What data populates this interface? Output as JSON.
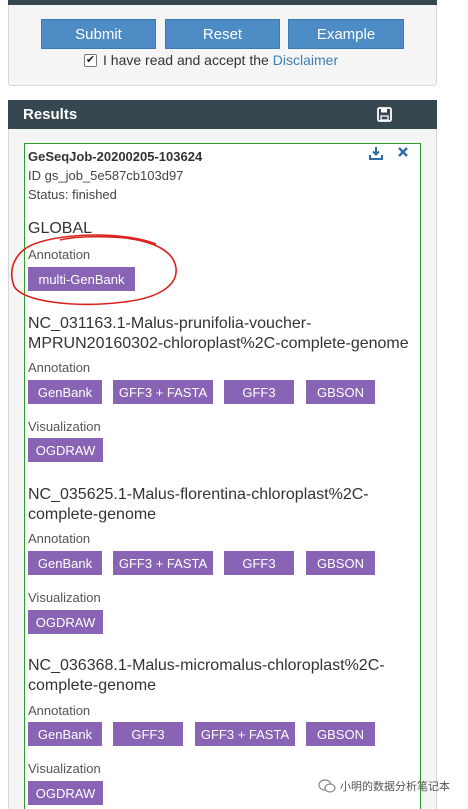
{
  "form": {
    "submit_label": "Submit",
    "reset_label": "Reset",
    "example_label": "Example",
    "disclaimer_checked": true,
    "disclaimer_text": "I have read and accept the",
    "disclaimer_link": "Disclaimer"
  },
  "results": {
    "header": "Results",
    "job": {
      "title": "GeSeqJob-20200205-103624",
      "id": "ID gs_job_5e587cb103d97",
      "status": "Status: finished"
    },
    "global": {
      "title": "GLOBAL",
      "annotation_label": "Annotation",
      "buttons": [
        "multi-GenBank"
      ]
    },
    "genomes": [
      {
        "title": "NC_031163.1-Malus-prunifolia-voucher-MPRUN20160302-chloroplast%2C-complete-genome",
        "annotation_label": "Annotation",
        "annotation_buttons": [
          "GenBank",
          "GFF3 + FASTA",
          "GFF3",
          "GBSON"
        ],
        "visualization_label": "Visualization",
        "visualization_buttons": [
          "OGDRAW"
        ]
      },
      {
        "title": "NC_035625.1-Malus-florentina-chloroplast%2C-complete-genome",
        "annotation_label": "Annotation",
        "annotation_buttons": [
          "GenBank",
          "GFF3 + FASTA",
          "GFF3",
          "GBSON"
        ],
        "visualization_label": "Visualization",
        "visualization_buttons": [
          "OGDRAW"
        ]
      },
      {
        "title": "NC_036368.1-Malus-micromalus-chloroplast%2C-complete-genome",
        "annotation_label": "Annotation",
        "annotation_buttons": [
          "GenBank",
          "GFF3",
          "GFF3 + FASTA",
          "GBSON"
        ],
        "visualization_label": "Visualization",
        "visualization_buttons": [
          "OGDRAW"
        ]
      }
    ]
  },
  "watermark": "小明的数据分析笔记本",
  "colors": {
    "header_bg": "#37474f",
    "primary_button": "#4d8cc4",
    "format_button": "#8a64b4",
    "job_border": "#2e9d2e",
    "annotation_circle": "#d9231f"
  }
}
